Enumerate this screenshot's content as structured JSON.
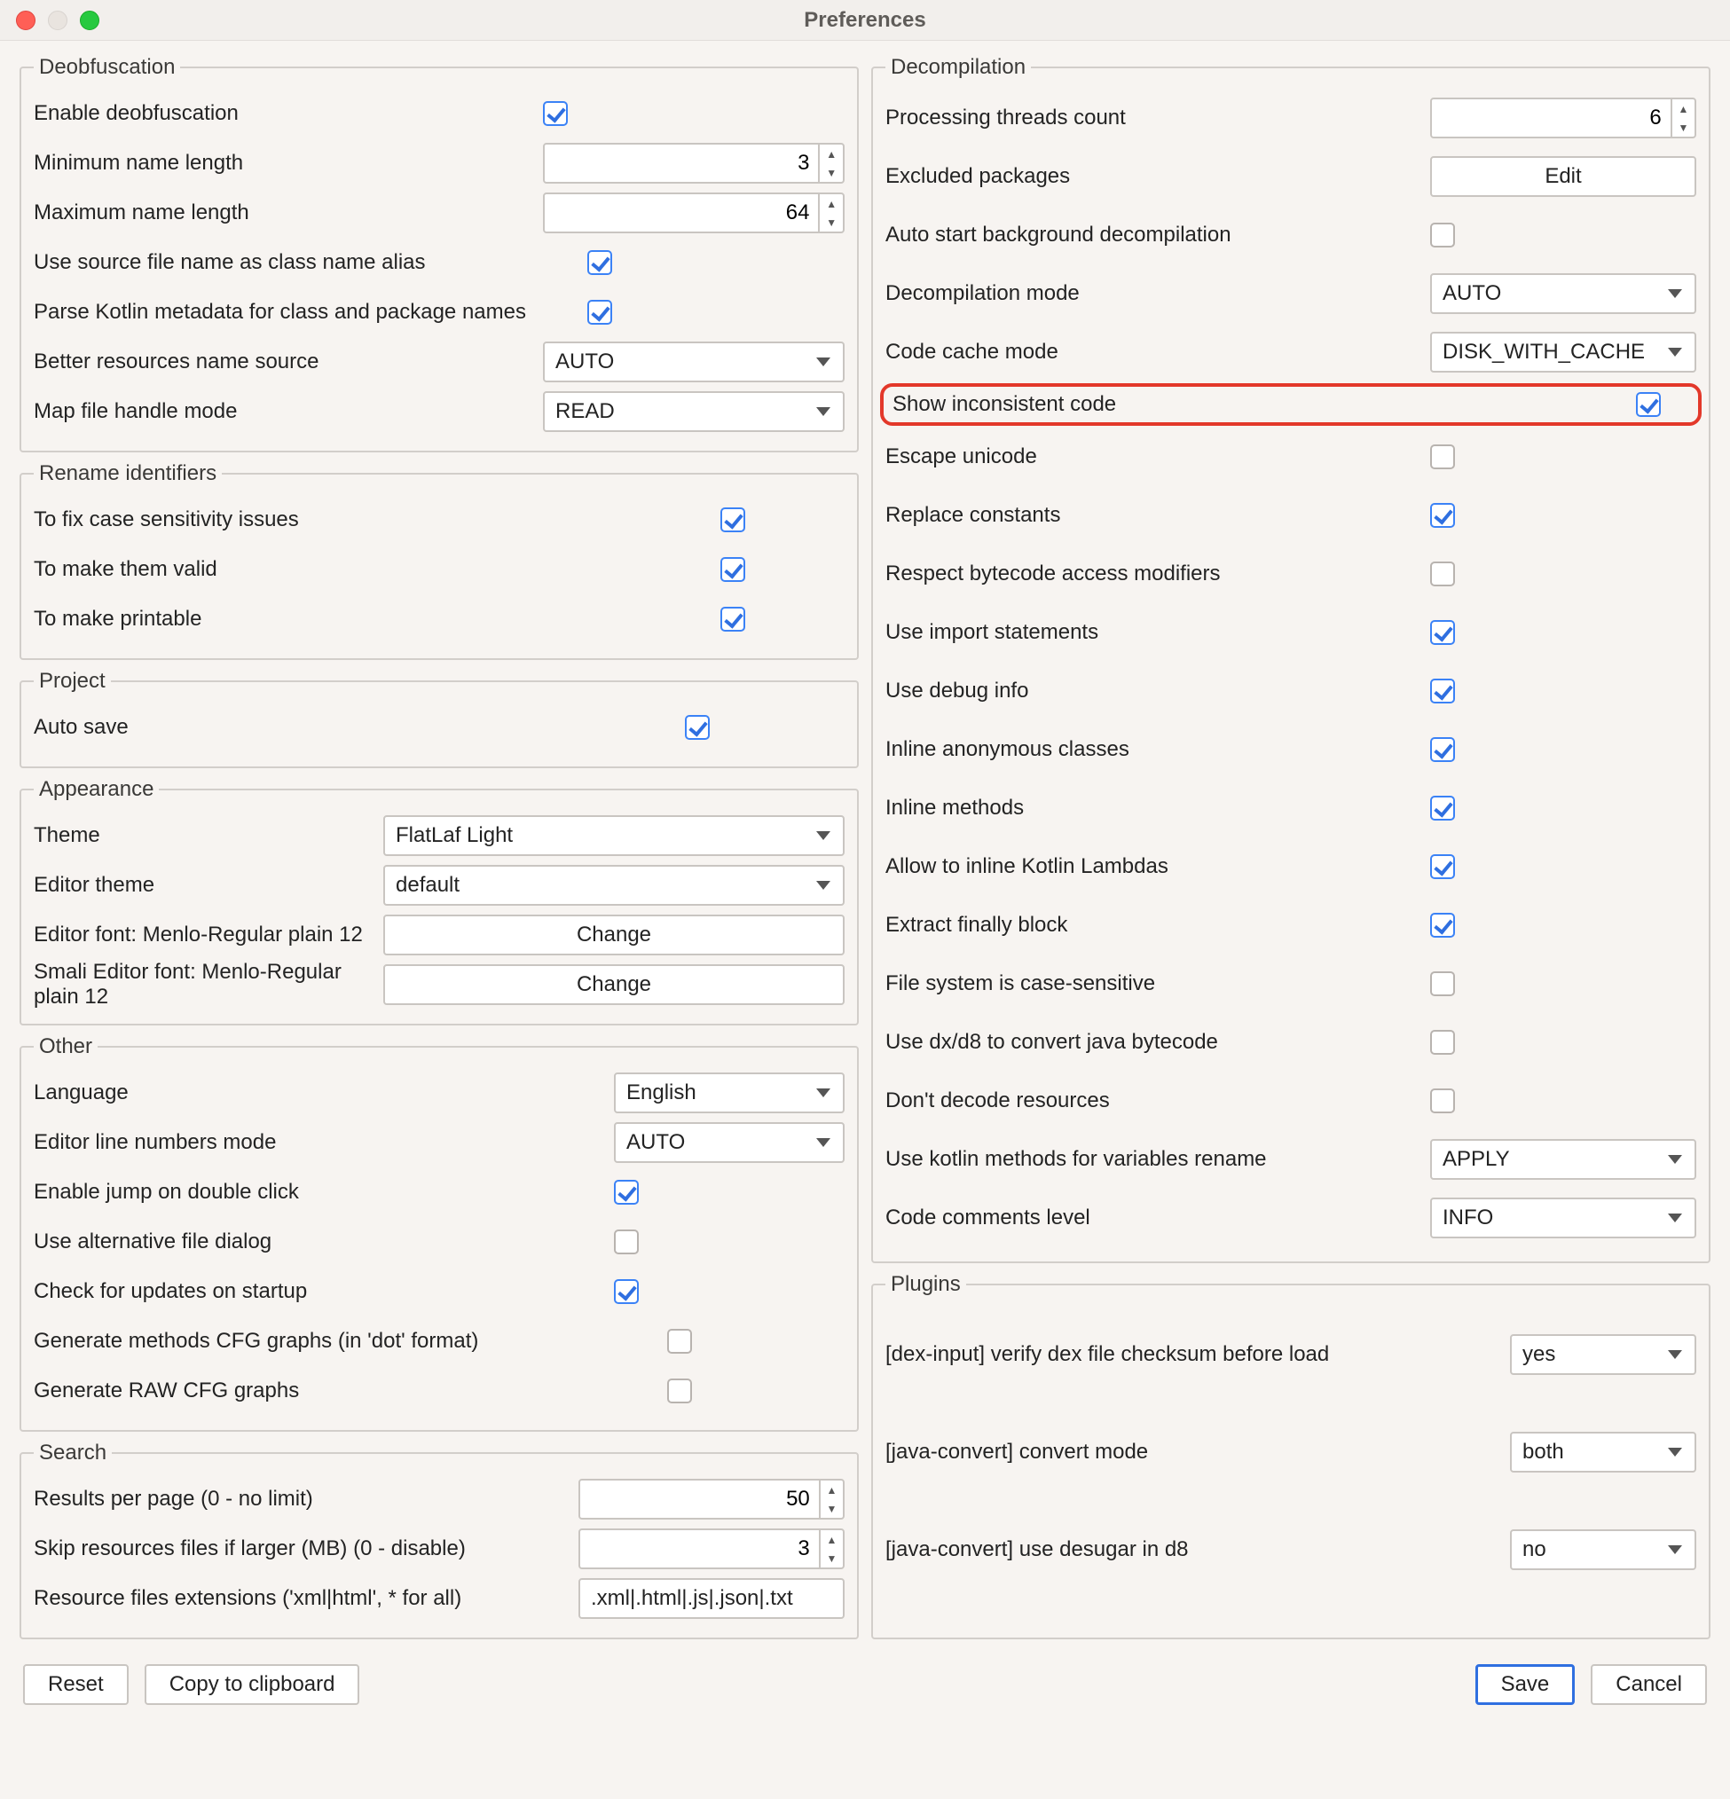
{
  "window": {
    "title": "Preferences"
  },
  "footer": {
    "reset": "Reset",
    "copy": "Copy to clipboard",
    "save": "Save",
    "cancel": "Cancel"
  },
  "left": {
    "deobf": {
      "legend": "Deobfuscation",
      "enable": {
        "label": "Enable deobfuscation",
        "checked": true
      },
      "min_name": {
        "label": "Minimum name length",
        "value": "3"
      },
      "max_name": {
        "label": "Maximum name length",
        "value": "64"
      },
      "src_alias": {
        "label": "Use source file name as class name alias",
        "checked": true
      },
      "kotlin_meta": {
        "label": "Parse Kotlin metadata for class and package names",
        "checked": true
      },
      "resources_src": {
        "label": "Better resources name source",
        "value": "AUTO"
      },
      "map_file": {
        "label": "Map file handle mode",
        "value": "READ"
      }
    },
    "rename": {
      "legend": "Rename identifiers",
      "case": {
        "label": "To fix case sensitivity issues",
        "checked": true
      },
      "valid": {
        "label": "To make them valid",
        "checked": true
      },
      "printable": {
        "label": "To make printable",
        "checked": true
      }
    },
    "project": {
      "legend": "Project",
      "autosave": {
        "label": "Auto save",
        "checked": true
      }
    },
    "appearance": {
      "legend": "Appearance",
      "theme": {
        "label": "Theme",
        "value": "FlatLaf Light"
      },
      "editor_theme": {
        "label": "Editor theme",
        "value": "default"
      },
      "editor_font": {
        "label": "Editor font: Menlo-Regular plain 12",
        "btn": "Change"
      },
      "smali_font": {
        "label": "Smali Editor font: Menlo-Regular plain 12",
        "btn": "Change"
      }
    },
    "other": {
      "legend": "Other",
      "language": {
        "label": "Language",
        "value": "English"
      },
      "line_numbers": {
        "label": "Editor line numbers mode",
        "value": "AUTO"
      },
      "jump_dbl": {
        "label": "Enable jump on double click",
        "checked": true
      },
      "alt_dialog": {
        "label": "Use alternative file dialog",
        "checked": false
      },
      "check_updates": {
        "label": "Check for updates on startup",
        "checked": true
      },
      "cfg_dot": {
        "label": "Generate methods CFG graphs (in 'dot' format)",
        "checked": false
      },
      "cfg_raw": {
        "label": "Generate RAW CFG graphs",
        "checked": false
      }
    },
    "search": {
      "legend": "Search",
      "results": {
        "label": "Results per page (0 - no limit)",
        "value": "50"
      },
      "skip_res": {
        "label": "Skip resources files if larger (MB) (0 - disable)",
        "value": "3"
      },
      "ext": {
        "label": "Resource files extensions ('xml|html', * for all)",
        "value": ".xml|.html|.js|.json|.txt"
      }
    }
  },
  "right": {
    "decomp": {
      "legend": "Decompilation",
      "threads": {
        "label": "Processing threads count",
        "value": "6"
      },
      "excluded": {
        "label": "Excluded packages",
        "btn": "Edit"
      },
      "auto_start": {
        "label": "Auto start background decompilation",
        "checked": false
      },
      "mode": {
        "label": "Decompilation mode",
        "value": "AUTO"
      },
      "cache": {
        "label": "Code cache mode",
        "value": "DISK_WITH_CACHE"
      },
      "inconsistent": {
        "label": "Show inconsistent code",
        "checked": true
      },
      "escape": {
        "label": "Escape unicode",
        "checked": false
      },
      "replace_const": {
        "label": "Replace constants",
        "checked": true
      },
      "respect_bc": {
        "label": "Respect bytecode access modifiers",
        "checked": false
      },
      "use_import": {
        "label": "Use import statements",
        "checked": true
      },
      "debug_info": {
        "label": "Use debug info",
        "checked": true
      },
      "inline_anon": {
        "label": "Inline anonymous classes",
        "checked": true
      },
      "inline_methods": {
        "label": "Inline methods",
        "checked": true
      },
      "kotlin_lambdas": {
        "label": "Allow to inline Kotlin Lambdas",
        "checked": true
      },
      "finally": {
        "label": "Extract finally block",
        "checked": true
      },
      "case_sensitive": {
        "label": "File system is case-sensitive",
        "checked": false
      },
      "dx_d8": {
        "label": "Use dx/d8 to convert java bytecode",
        "checked": false
      },
      "no_decode_res": {
        "label": "Don't decode resources",
        "checked": false
      },
      "kotlin_rename": {
        "label": "Use kotlin methods for variables rename",
        "value": "APPLY"
      },
      "comments": {
        "label": "Code comments level",
        "value": "INFO"
      }
    },
    "plugins": {
      "legend": "Plugins",
      "dex_input": {
        "label": "[dex-input]  verify dex file checksum before load",
        "value": "yes"
      },
      "convert_mode": {
        "label": "[java-convert]  convert mode",
        "value": "both"
      },
      "desugar": {
        "label": "[java-convert]  use desugar in d8",
        "value": "no"
      }
    }
  }
}
